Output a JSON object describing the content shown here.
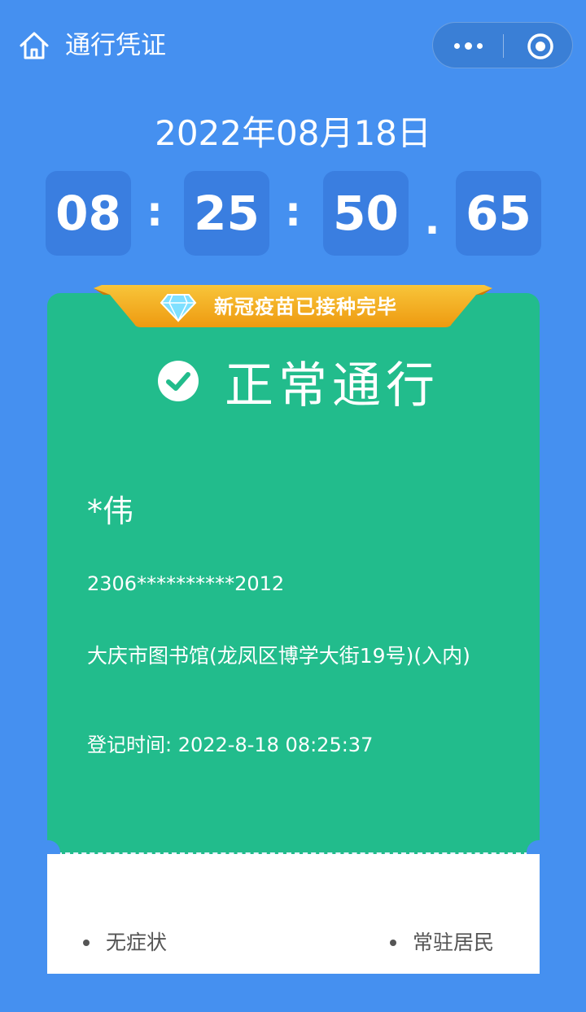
{
  "header": {
    "title": "通行凭证",
    "home_icon": "home-icon",
    "more_icon": "more-dots-icon",
    "close_icon": "mini-program-close-icon"
  },
  "clock": {
    "date": "2022年08月18日",
    "hours": "08",
    "sep1": ":",
    "minutes": "25",
    "sep2": ":",
    "seconds": "50",
    "sep3": ".",
    "centiseconds": "65"
  },
  "card": {
    "vaccine_badge": "新冠疫苗已接种完毕",
    "badge_icon": "diamond-icon",
    "status_icon": "check-circle-icon",
    "status": "正常通行",
    "name": "*伟",
    "id_number": "2306**********2012",
    "location": "大庆市图书馆(龙凤区博学大街19号)(入内)",
    "registration": "登记时间: 2022-8-18 08:25:37"
  },
  "tags": {
    "left": "无症状",
    "right": "常驻居民"
  },
  "colors": {
    "background": "#4590f0",
    "time_box": "#3a7ee0",
    "card_green": "#22bc8c",
    "ribbon_orange": "#f2a415"
  }
}
